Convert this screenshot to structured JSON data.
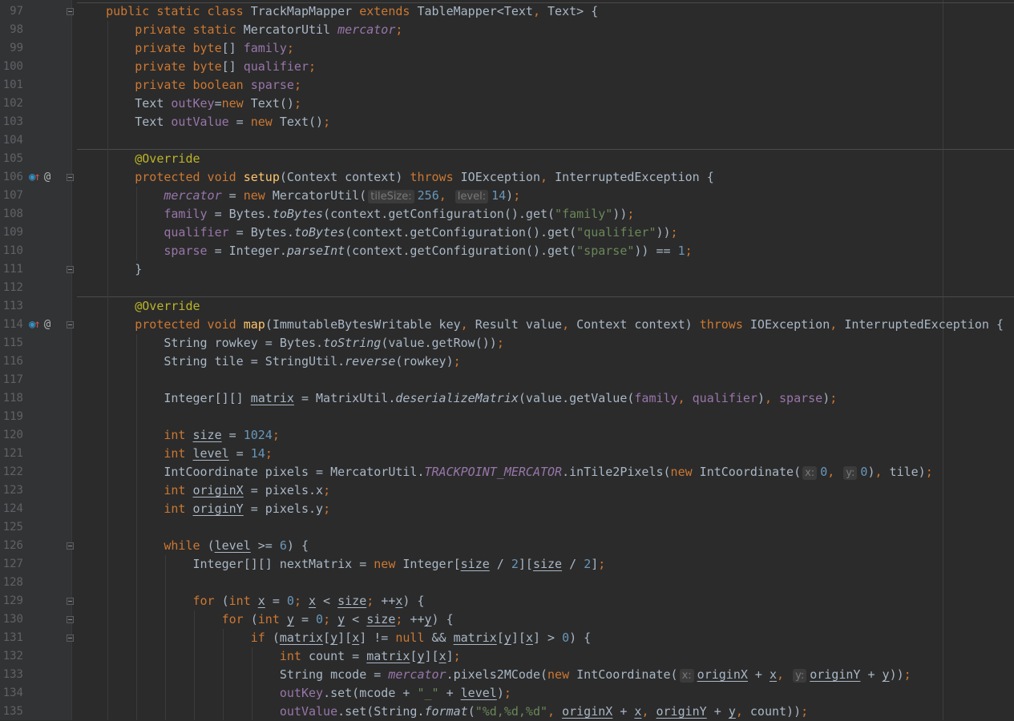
{
  "editor": {
    "colors": {
      "background": "#2b2b2b",
      "gutter": "#313335",
      "keyword": "#cc7832",
      "field": "#9876aa",
      "string": "#6a8759",
      "number": "#6897bb",
      "annotation": "#bbb529",
      "method_decl": "#ffc66d",
      "text": "#a9b7c6"
    },
    "lines": [
      {
        "n": "97",
        "indent": 4,
        "fold": true,
        "t": [
          [
            "k",
            "public static class "
          ],
          [
            "p",
            "TrackMapMapper "
          ],
          [
            "k",
            "extends "
          ],
          [
            "p",
            "TableMapper<Text"
          ],
          [
            "k",
            ", "
          ],
          [
            "p",
            "Text> {"
          ]
        ]
      },
      {
        "n": "98",
        "indent": 8,
        "t": [
          [
            "k",
            "private static "
          ],
          [
            "p",
            "MercatorUtil "
          ],
          [
            "fi",
            "mercator"
          ],
          [
            "k",
            ";"
          ]
        ]
      },
      {
        "n": "99",
        "indent": 8,
        "t": [
          [
            "k",
            "private byte"
          ],
          [
            "p",
            "[] "
          ],
          [
            "f",
            "family"
          ],
          [
            "k",
            ";"
          ]
        ]
      },
      {
        "n": "100",
        "indent": 8,
        "t": [
          [
            "k",
            "private byte"
          ],
          [
            "p",
            "[] "
          ],
          [
            "f",
            "qualifier"
          ],
          [
            "k",
            ";"
          ]
        ]
      },
      {
        "n": "101",
        "indent": 8,
        "t": [
          [
            "k",
            "private boolean "
          ],
          [
            "f",
            "sparse"
          ],
          [
            "k",
            ";"
          ]
        ]
      },
      {
        "n": "102",
        "indent": 8,
        "t": [
          [
            "p",
            "Text "
          ],
          [
            "f",
            "outKey"
          ],
          [
            "p",
            "="
          ],
          [
            "k",
            "new "
          ],
          [
            "p",
            "Text()"
          ],
          [
            "k",
            ";"
          ]
        ]
      },
      {
        "n": "103",
        "indent": 8,
        "t": [
          [
            "p",
            "Text "
          ],
          [
            "f",
            "outValue"
          ],
          [
            "p",
            " = "
          ],
          [
            "k",
            "new "
          ],
          [
            "p",
            "Text()"
          ],
          [
            "k",
            ";"
          ]
        ]
      },
      {
        "n": "104",
        "indent": 0,
        "t": []
      },
      {
        "n": "105",
        "indent": 8,
        "t": [
          [
            "a",
            "@Override"
          ]
        ]
      },
      {
        "n": "106",
        "indent": 8,
        "fold": true,
        "icons": [
          "override-icon",
          "annotation-icon"
        ],
        "t": [
          [
            "k",
            "protected void "
          ],
          [
            "m",
            "setup"
          ],
          [
            "p",
            "(Context context) "
          ],
          [
            "k",
            "throws "
          ],
          [
            "p",
            "IOException"
          ],
          [
            "k",
            ", "
          ],
          [
            "p",
            "InterruptedException {"
          ]
        ]
      },
      {
        "n": "107",
        "indent": 12,
        "t": [
          [
            "fi",
            "mercator"
          ],
          [
            "p",
            " = "
          ],
          [
            "k",
            "new "
          ],
          [
            "p",
            "MercatorUtil("
          ],
          [
            "h",
            "tileSize:"
          ],
          [
            "n",
            "256"
          ],
          [
            "k",
            ", "
          ],
          [
            "h",
            "level:"
          ],
          [
            "n",
            "14"
          ],
          [
            "p",
            ")"
          ],
          [
            "k",
            ";"
          ]
        ]
      },
      {
        "n": "108",
        "indent": 12,
        "t": [
          [
            "f",
            "family"
          ],
          [
            "p",
            " = Bytes."
          ],
          [
            "si",
            "toBytes"
          ],
          [
            "p",
            "(context.getConfiguration().get("
          ],
          [
            "s",
            "\"family\""
          ],
          [
            "p",
            "))"
          ],
          [
            "k",
            ";"
          ]
        ]
      },
      {
        "n": "109",
        "indent": 12,
        "t": [
          [
            "f",
            "qualifier"
          ],
          [
            "p",
            " = Bytes."
          ],
          [
            "si",
            "toBytes"
          ],
          [
            "p",
            "(context.getConfiguration().get("
          ],
          [
            "s",
            "\"qualifier\""
          ],
          [
            "p",
            "))"
          ],
          [
            "k",
            ";"
          ]
        ]
      },
      {
        "n": "110",
        "indent": 12,
        "t": [
          [
            "f",
            "sparse"
          ],
          [
            "p",
            " = Integer."
          ],
          [
            "si",
            "parseInt"
          ],
          [
            "p",
            "(context.getConfiguration().get("
          ],
          [
            "s",
            "\"sparse\""
          ],
          [
            "p",
            ")) == "
          ],
          [
            "n",
            "1"
          ],
          [
            "k",
            ";"
          ]
        ]
      },
      {
        "n": "111",
        "indent": 8,
        "fold": true,
        "t": [
          [
            "p",
            "}"
          ]
        ]
      },
      {
        "n": "112",
        "indent": 0,
        "t": []
      },
      {
        "n": "113",
        "indent": 8,
        "t": [
          [
            "a",
            "@Override"
          ]
        ]
      },
      {
        "n": "114",
        "indent": 8,
        "fold": true,
        "icons": [
          "override-icon",
          "annotation-icon"
        ],
        "t": [
          [
            "k",
            "protected void "
          ],
          [
            "m",
            "map"
          ],
          [
            "p",
            "(ImmutableBytesWritable key"
          ],
          [
            "k",
            ", "
          ],
          [
            "p",
            "Result value"
          ],
          [
            "k",
            ", "
          ],
          [
            "p",
            "Context context) "
          ],
          [
            "k",
            "throws "
          ],
          [
            "p",
            "IOException"
          ],
          [
            "k",
            ", "
          ],
          [
            "p",
            "InterruptedException {"
          ]
        ]
      },
      {
        "n": "115",
        "indent": 12,
        "t": [
          [
            "p",
            "String rowkey = Bytes."
          ],
          [
            "si",
            "toString"
          ],
          [
            "p",
            "(value.getRow())"
          ],
          [
            "k",
            ";"
          ]
        ]
      },
      {
        "n": "116",
        "indent": 12,
        "t": [
          [
            "p",
            "String tile = StringUtil."
          ],
          [
            "si",
            "reverse"
          ],
          [
            "p",
            "(rowkey)"
          ],
          [
            "k",
            ";"
          ]
        ]
      },
      {
        "n": "117",
        "indent": 0,
        "t": []
      },
      {
        "n": "118",
        "indent": 12,
        "t": [
          [
            "p",
            "Integer[][] "
          ],
          [
            "u",
            "matrix"
          ],
          [
            "p",
            " = MatrixUtil."
          ],
          [
            "si",
            "deserializeMatrix"
          ],
          [
            "p",
            "(value.getValue("
          ],
          [
            "f",
            "family"
          ],
          [
            "k",
            ", "
          ],
          [
            "f",
            "qualifier"
          ],
          [
            "p",
            ")"
          ],
          [
            "k",
            ", "
          ],
          [
            "f",
            "sparse"
          ],
          [
            "p",
            ")"
          ],
          [
            "k",
            ";"
          ]
        ]
      },
      {
        "n": "119",
        "indent": 0,
        "t": []
      },
      {
        "n": "120",
        "indent": 12,
        "t": [
          [
            "k",
            "int "
          ],
          [
            "u",
            "size"
          ],
          [
            "p",
            " = "
          ],
          [
            "n",
            "1024"
          ],
          [
            "k",
            ";"
          ]
        ]
      },
      {
        "n": "121",
        "indent": 12,
        "t": [
          [
            "k",
            "int "
          ],
          [
            "u",
            "level"
          ],
          [
            "p",
            " = "
          ],
          [
            "n",
            "14"
          ],
          [
            "k",
            ";"
          ]
        ]
      },
      {
        "n": "122",
        "indent": 12,
        "t": [
          [
            "p",
            "IntCoordinate pixels = MercatorUtil."
          ],
          [
            "c",
            "TRACKPOINT_MERCATOR"
          ],
          [
            "p",
            ".inTile2Pixels("
          ],
          [
            "k",
            "new "
          ],
          [
            "p",
            "IntCoordinate("
          ],
          [
            "h",
            "x:"
          ],
          [
            "n",
            "0"
          ],
          [
            "k",
            ", "
          ],
          [
            "h",
            "y:"
          ],
          [
            "n",
            "0"
          ],
          [
            "p",
            ")"
          ],
          [
            "k",
            ", "
          ],
          [
            "p",
            "tile)"
          ],
          [
            "k",
            ";"
          ]
        ]
      },
      {
        "n": "123",
        "indent": 12,
        "t": [
          [
            "k",
            "int "
          ],
          [
            "u",
            "originX"
          ],
          [
            "p",
            " = pixels.x"
          ],
          [
            "k",
            ";"
          ]
        ]
      },
      {
        "n": "124",
        "indent": 12,
        "t": [
          [
            "k",
            "int "
          ],
          [
            "u",
            "originY"
          ],
          [
            "p",
            " = pixels.y"
          ],
          [
            "k",
            ";"
          ]
        ]
      },
      {
        "n": "125",
        "indent": 0,
        "t": []
      },
      {
        "n": "126",
        "indent": 12,
        "fold": true,
        "t": [
          [
            "k",
            "while "
          ],
          [
            "p",
            "("
          ],
          [
            "u",
            "level"
          ],
          [
            "p",
            " >= "
          ],
          [
            "n",
            "6"
          ],
          [
            "p",
            ") {"
          ]
        ]
      },
      {
        "n": "127",
        "indent": 16,
        "t": [
          [
            "p",
            "Integer[][] nextMatrix = "
          ],
          [
            "k",
            "new "
          ],
          [
            "p",
            "Integer["
          ],
          [
            "u",
            "size"
          ],
          [
            "p",
            " / "
          ],
          [
            "n",
            "2"
          ],
          [
            "p",
            "]["
          ],
          [
            "u",
            "size"
          ],
          [
            "p",
            " / "
          ],
          [
            "n",
            "2"
          ],
          [
            "p",
            "]"
          ],
          [
            "k",
            ";"
          ]
        ]
      },
      {
        "n": "128",
        "indent": 0,
        "t": []
      },
      {
        "n": "129",
        "indent": 16,
        "fold": true,
        "t": [
          [
            "k",
            "for "
          ],
          [
            "p",
            "("
          ],
          [
            "k",
            "int "
          ],
          [
            "u",
            "x"
          ],
          [
            "p",
            " = "
          ],
          [
            "n",
            "0"
          ],
          [
            "k",
            "; "
          ],
          [
            "u",
            "x"
          ],
          [
            "p",
            " < "
          ],
          [
            "u",
            "size"
          ],
          [
            "k",
            "; "
          ],
          [
            "p",
            "++"
          ],
          [
            "u",
            "x"
          ],
          [
            "p",
            ") {"
          ]
        ]
      },
      {
        "n": "130",
        "indent": 20,
        "fold": true,
        "t": [
          [
            "k",
            "for "
          ],
          [
            "p",
            "("
          ],
          [
            "k",
            "int "
          ],
          [
            "u",
            "y"
          ],
          [
            "p",
            " = "
          ],
          [
            "n",
            "0"
          ],
          [
            "k",
            "; "
          ],
          [
            "u",
            "y"
          ],
          [
            "p",
            " < "
          ],
          [
            "u",
            "size"
          ],
          [
            "k",
            "; "
          ],
          [
            "p",
            "++"
          ],
          [
            "u",
            "y"
          ],
          [
            "p",
            ") {"
          ]
        ]
      },
      {
        "n": "131",
        "indent": 24,
        "fold": true,
        "t": [
          [
            "k",
            "if "
          ],
          [
            "p",
            "("
          ],
          [
            "u",
            "matrix"
          ],
          [
            "p",
            "["
          ],
          [
            "u",
            "y"
          ],
          [
            "p",
            "]["
          ],
          [
            "u",
            "x"
          ],
          [
            "p",
            "] != "
          ],
          [
            "k",
            "null "
          ],
          [
            "p",
            "&& "
          ],
          [
            "u",
            "matrix"
          ],
          [
            "p",
            "["
          ],
          [
            "u",
            "y"
          ],
          [
            "p",
            "]["
          ],
          [
            "u",
            "x"
          ],
          [
            "p",
            "] > "
          ],
          [
            "n",
            "0"
          ],
          [
            "p",
            ") {"
          ]
        ]
      },
      {
        "n": "132",
        "indent": 28,
        "t": [
          [
            "k",
            "int "
          ],
          [
            "p",
            "count = "
          ],
          [
            "u",
            "matrix"
          ],
          [
            "p",
            "["
          ],
          [
            "u",
            "y"
          ],
          [
            "p",
            "]["
          ],
          [
            "u",
            "x"
          ],
          [
            "p",
            "]"
          ],
          [
            "k",
            ";"
          ]
        ]
      },
      {
        "n": "133",
        "indent": 28,
        "t": [
          [
            "p",
            "String mcode = "
          ],
          [
            "fi",
            "mercator"
          ],
          [
            "p",
            ".pixels2MCode("
          ],
          [
            "k",
            "new "
          ],
          [
            "p",
            "IntCoordinate("
          ],
          [
            "h",
            "x:"
          ],
          [
            "u",
            "originX"
          ],
          [
            "p",
            " + "
          ],
          [
            "u",
            "x"
          ],
          [
            "k",
            ", "
          ],
          [
            "h",
            "y:"
          ],
          [
            "u",
            "originY"
          ],
          [
            "p",
            " + "
          ],
          [
            "u",
            "y"
          ],
          [
            "p",
            "))"
          ],
          [
            "k",
            ";"
          ]
        ]
      },
      {
        "n": "134",
        "indent": 28,
        "t": [
          [
            "f",
            "outKey"
          ],
          [
            "p",
            ".set(mcode + "
          ],
          [
            "s",
            "\"_\""
          ],
          [
            "p",
            " + "
          ],
          [
            "u",
            "level"
          ],
          [
            "p",
            ")"
          ],
          [
            "k",
            ";"
          ]
        ]
      },
      {
        "n": "135",
        "indent": 28,
        "t": [
          [
            "f",
            "outValue"
          ],
          [
            "p",
            ".set(String."
          ],
          [
            "si",
            "format"
          ],
          [
            "p",
            "("
          ],
          [
            "s",
            "\"%d,%d,%d\""
          ],
          [
            "k",
            ", "
          ],
          [
            "u",
            "originX"
          ],
          [
            "p",
            " + "
          ],
          [
            "u",
            "x"
          ],
          [
            "k",
            ", "
          ],
          [
            "u",
            "originY"
          ],
          [
            "p",
            " + "
          ],
          [
            "u",
            "y"
          ],
          [
            "k",
            ", "
          ],
          [
            "p",
            "count))"
          ],
          [
            "k",
            ";"
          ]
        ]
      }
    ]
  }
}
